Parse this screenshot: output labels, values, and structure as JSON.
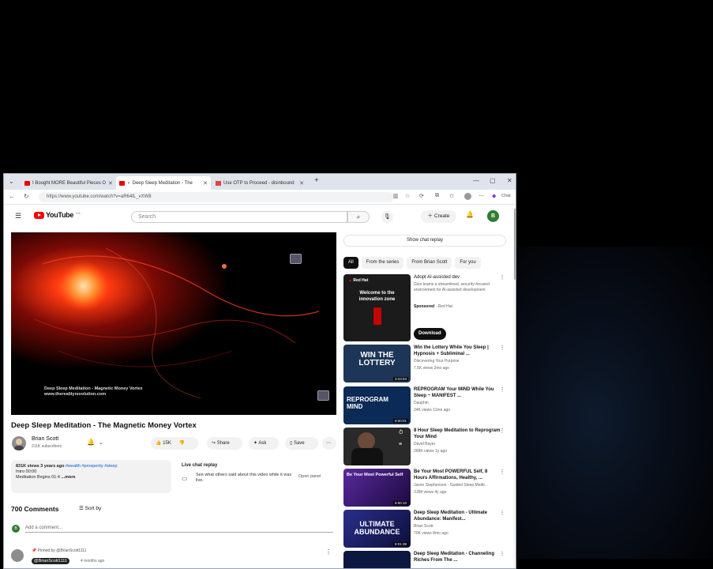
{
  "browser": {
    "tabs": [
      {
        "label": "I Bought MORE Beautiful Pieces O",
        "active": false
      },
      {
        "label": "Deep Sleep Meditation - The",
        "active": true
      },
      {
        "label": "Use OTP to Proceed - disinbound",
        "active": false
      }
    ],
    "new_tab": "+",
    "url": "https://www.youtube.com/watch?v=aR64tL_vXW8"
  },
  "youtube": {
    "logo_text": "YouTube",
    "country_code": "CA",
    "search_placeholder": "Search",
    "create_label": "Create",
    "avatar_letter": "B"
  },
  "player": {
    "overlay_line1": "Deep Sleep Meditation - Magnetic Money Vortex",
    "overlay_line2": "www.therealityrevolution.com"
  },
  "video": {
    "title": "Deep Sleep Meditation - The Magnetic Money Vortex",
    "channel": "Brian Scott",
    "subscribers": "211K subscribers",
    "likes": "15K",
    "share_label": "Share",
    "ask_label": "Ask",
    "save_label": "Save",
    "views_age": "831K views  3 years ago",
    "hashtags": "#wealth #prosperity #sleep",
    "desc_line2": "Intro 00:00",
    "desc_line3": "Meditation Begins 01:4",
    "more": "...more"
  },
  "live_chat_replay": {
    "title": "Live chat replay",
    "text": "See what others said about this video while it was live.",
    "button": "Open panel"
  },
  "comments": {
    "count_label": "700 Comments",
    "sort_label": "Sort by",
    "add_placeholder": "Add a comment...",
    "my_avatar": "B",
    "pinned_label": "Pinned by @BrianScott1111",
    "pinned_author": "@BrianScott1111",
    "pinned_age": "4 months ago"
  },
  "sidebar": {
    "show_chat_replay": "Show chat replay",
    "filters": [
      "All",
      "From the series",
      "From Brian Scott",
      "For you"
    ],
    "ad": {
      "title": "Adopt AI-assisted dev",
      "description": "Give teams a streamlined, security-focused environment for AI-assisted development",
      "sponsored": "Sponsored",
      "advertiser": "Red Hat",
      "button": "Download",
      "thumb_brand": "Red Hat",
      "thumb_line1": "Welcome to the",
      "thumb_line2": "innovation zone"
    },
    "recommendations": [
      {
        "title": "Win the Lottery While You Sleep | Hypnosis + Subliminal ...",
        "channel": "Discovering Your Purpose",
        "meta": "7.5K views  2mo ago",
        "duration": "3:23:03",
        "thumb_text": "WIN THE LOTTERY",
        "thumb_color": "#1d3557"
      },
      {
        "title": "REPROGRAM Your MIND While You Sleep ~ MANIFEST ...",
        "channel": "Dauphin",
        "meta": "24K views  11mo ago",
        "duration": "8:00:01",
        "thumb_text": "REPROGRAM MIND",
        "thumb_color": "#0b2a55"
      },
      {
        "title": "8 Hour Sleep Meditation to Reprogram Your Mind",
        "channel": "David Bayer",
        "meta": "268K views  1y ago",
        "duration": "",
        "thumb_text": "",
        "thumb_color": "#2a2a2a"
      },
      {
        "title": "Be Your Most POWERFUL Self, 8 Hours Affirmations, Healthy, ...",
        "channel": "Jason Stephenson - Guided Sleep Medit...",
        "meta": "3.8M views  4y ago",
        "duration": "8:00:10",
        "thumb_text": "Be Your Most Powerful Self",
        "thumb_color": "#3a1d6e"
      },
      {
        "title": "Deep Sleep Meditation - Ultimate Abundance: Manifest...",
        "channel": "Brian Scott",
        "meta": "70K views  8mo ago",
        "duration": "8:01:38",
        "thumb_text": "ULTIMATE ABUNDANCE",
        "thumb_color": "#1a1f5a"
      },
      {
        "title": "Deep Sleep Meditation - Channeling Riches From The ...",
        "channel": "",
        "meta": "",
        "duration": "",
        "thumb_text": "",
        "thumb_color": "#0d1840"
      }
    ]
  }
}
